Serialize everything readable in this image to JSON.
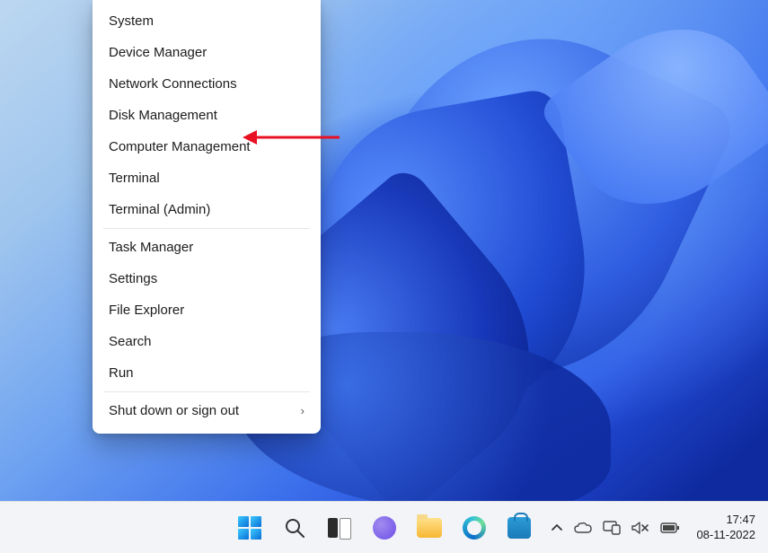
{
  "menu": {
    "group1": [
      {
        "label": "System"
      },
      {
        "label": "Device Manager"
      },
      {
        "label": "Network Connections"
      },
      {
        "label": "Disk Management"
      },
      {
        "label": "Computer Management"
      },
      {
        "label": "Terminal"
      },
      {
        "label": "Terminal (Admin)"
      }
    ],
    "group2": [
      {
        "label": "Task Manager"
      },
      {
        "label": "Settings"
      },
      {
        "label": "File Explorer"
      },
      {
        "label": "Search"
      },
      {
        "label": "Run"
      }
    ],
    "flyout": {
      "label": "Shut down or sign out"
    }
  },
  "annotation": {
    "arrow_target": "Disk Management",
    "arrow_color": "#e81123"
  },
  "taskbar": {
    "icons": [
      "start",
      "search",
      "task-view",
      "teams",
      "file-explorer",
      "edge",
      "store"
    ],
    "tray_icons": [
      "chevron-up",
      "onedrive",
      "screen-share",
      "volume-muted",
      "battery"
    ]
  },
  "clock": {
    "time": "17:47",
    "date": "08-11-2022"
  }
}
